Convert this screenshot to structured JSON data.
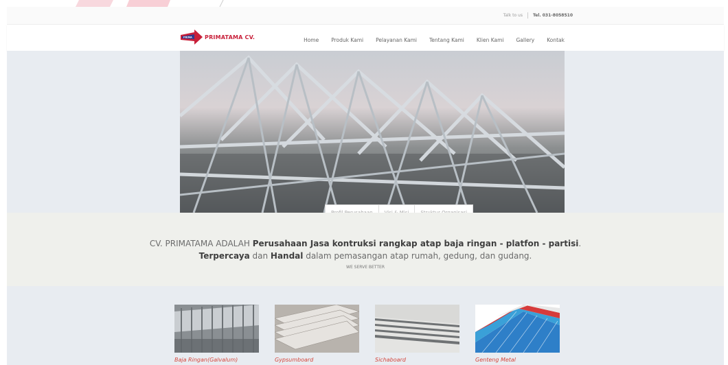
{
  "header": {
    "talk_label": "Talk to us",
    "tel_label": "Tel. 031-8058510"
  },
  "brand": {
    "name": "PRIMATAMA CV.",
    "accent_color": "#c8203a"
  },
  "nav": {
    "items": [
      "Home",
      "Produk Kami",
      "Pelayanan Kami",
      "Tentang Kami",
      "Klien Kami",
      "Gallery",
      "Kontak"
    ]
  },
  "hero": {
    "image_desc": "steel-truss-roof-photo"
  },
  "tabs": [
    "Profil Perusahaan",
    "Visi & Misi",
    "Struktur Organisasi"
  ],
  "intro": {
    "l1_prefix": "CV. PRIMATAMA ADALAH ",
    "l1_bold": "Perusahaan Jasa kontruksi rangkap atap baja ringan - platfon - partisi",
    "l1_suffix": ".",
    "l2_bold1": "Terpercaya",
    "l2_mid": " dan ",
    "l2_bold2": "Handal",
    "l2_suffix": " dalam pemasangan atap rumah, gedung, dan gudang.",
    "tagline": "WE SERVE BETTER"
  },
  "products": [
    {
      "name": "Baja Ringan(Galvalum)",
      "icon": "steel-panel-image"
    },
    {
      "name": "Gypsumboard",
      "icon": "gypsum-board-image"
    },
    {
      "name": "Sichaboard",
      "icon": "sichaboard-image"
    },
    {
      "name": "Genteng Metal",
      "icon": "metal-roof-tile-image"
    }
  ]
}
